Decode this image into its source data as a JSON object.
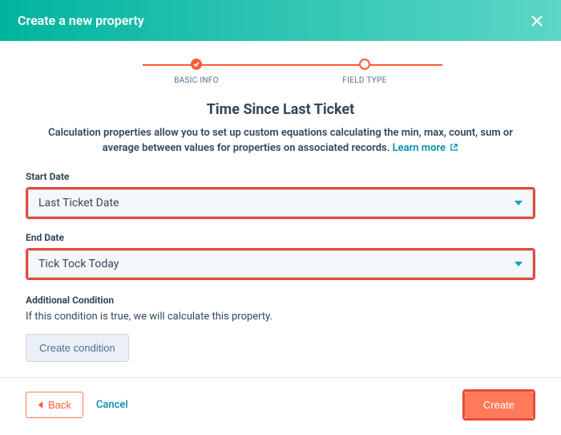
{
  "header": {
    "title": "Create a new property"
  },
  "stepper": {
    "step1": "BASIC INFO",
    "step2": "FIELD TYPE"
  },
  "main": {
    "title": "Time Since Last Ticket",
    "description": "Calculation properties allow you to set up custom equations calculating the min, max, count, sum or average between values for properties on associated records. ",
    "learnMore": "Learn more",
    "startDateLabel": "Start Date",
    "startDateValue": "Last Ticket Date",
    "endDateLabel": "End Date",
    "endDateValue": "Tick Tock Today",
    "additionalConditionTitle": "Additional Condition",
    "additionalConditionDesc": "If this condition is true, we will calculate this property.",
    "createConditionBtn": "Create condition"
  },
  "footer": {
    "back": "Back",
    "cancel": "Cancel",
    "create": "Create"
  }
}
